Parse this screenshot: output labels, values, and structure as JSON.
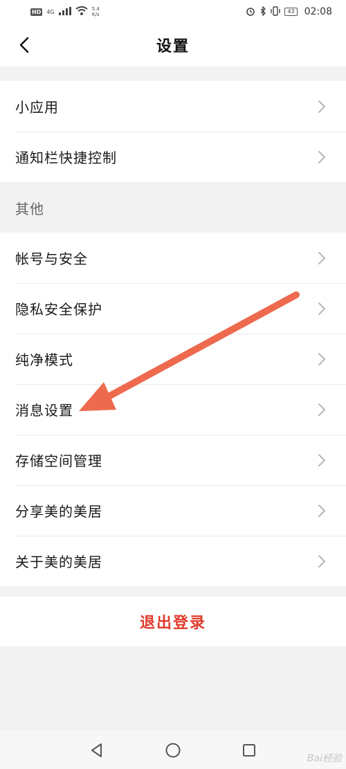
{
  "status_bar": {
    "hd": "HD",
    "signal_gen": "4G",
    "net_speed_value": "5.4",
    "net_speed_unit": "K/s",
    "battery": "43",
    "time": "02:08"
  },
  "header": {
    "title": "设置"
  },
  "group_top": {
    "items": [
      {
        "label": "小应用"
      },
      {
        "label": "通知栏快捷控制"
      }
    ]
  },
  "section_other": {
    "title": "其他"
  },
  "group_other": {
    "items": [
      {
        "label": "帐号与安全"
      },
      {
        "label": "隐私安全保护"
      },
      {
        "label": "纯净模式"
      },
      {
        "label": "消息设置"
      },
      {
        "label": "存储空间管理"
      },
      {
        "label": "分享美的美居"
      },
      {
        "label": "关于美的美居"
      }
    ]
  },
  "logout": {
    "label": "退出登录"
  },
  "colors": {
    "accent_red": "#e0392b",
    "arrow": "#ee6a4e",
    "background": "#f2f2f2"
  },
  "watermark": "Bai经验"
}
